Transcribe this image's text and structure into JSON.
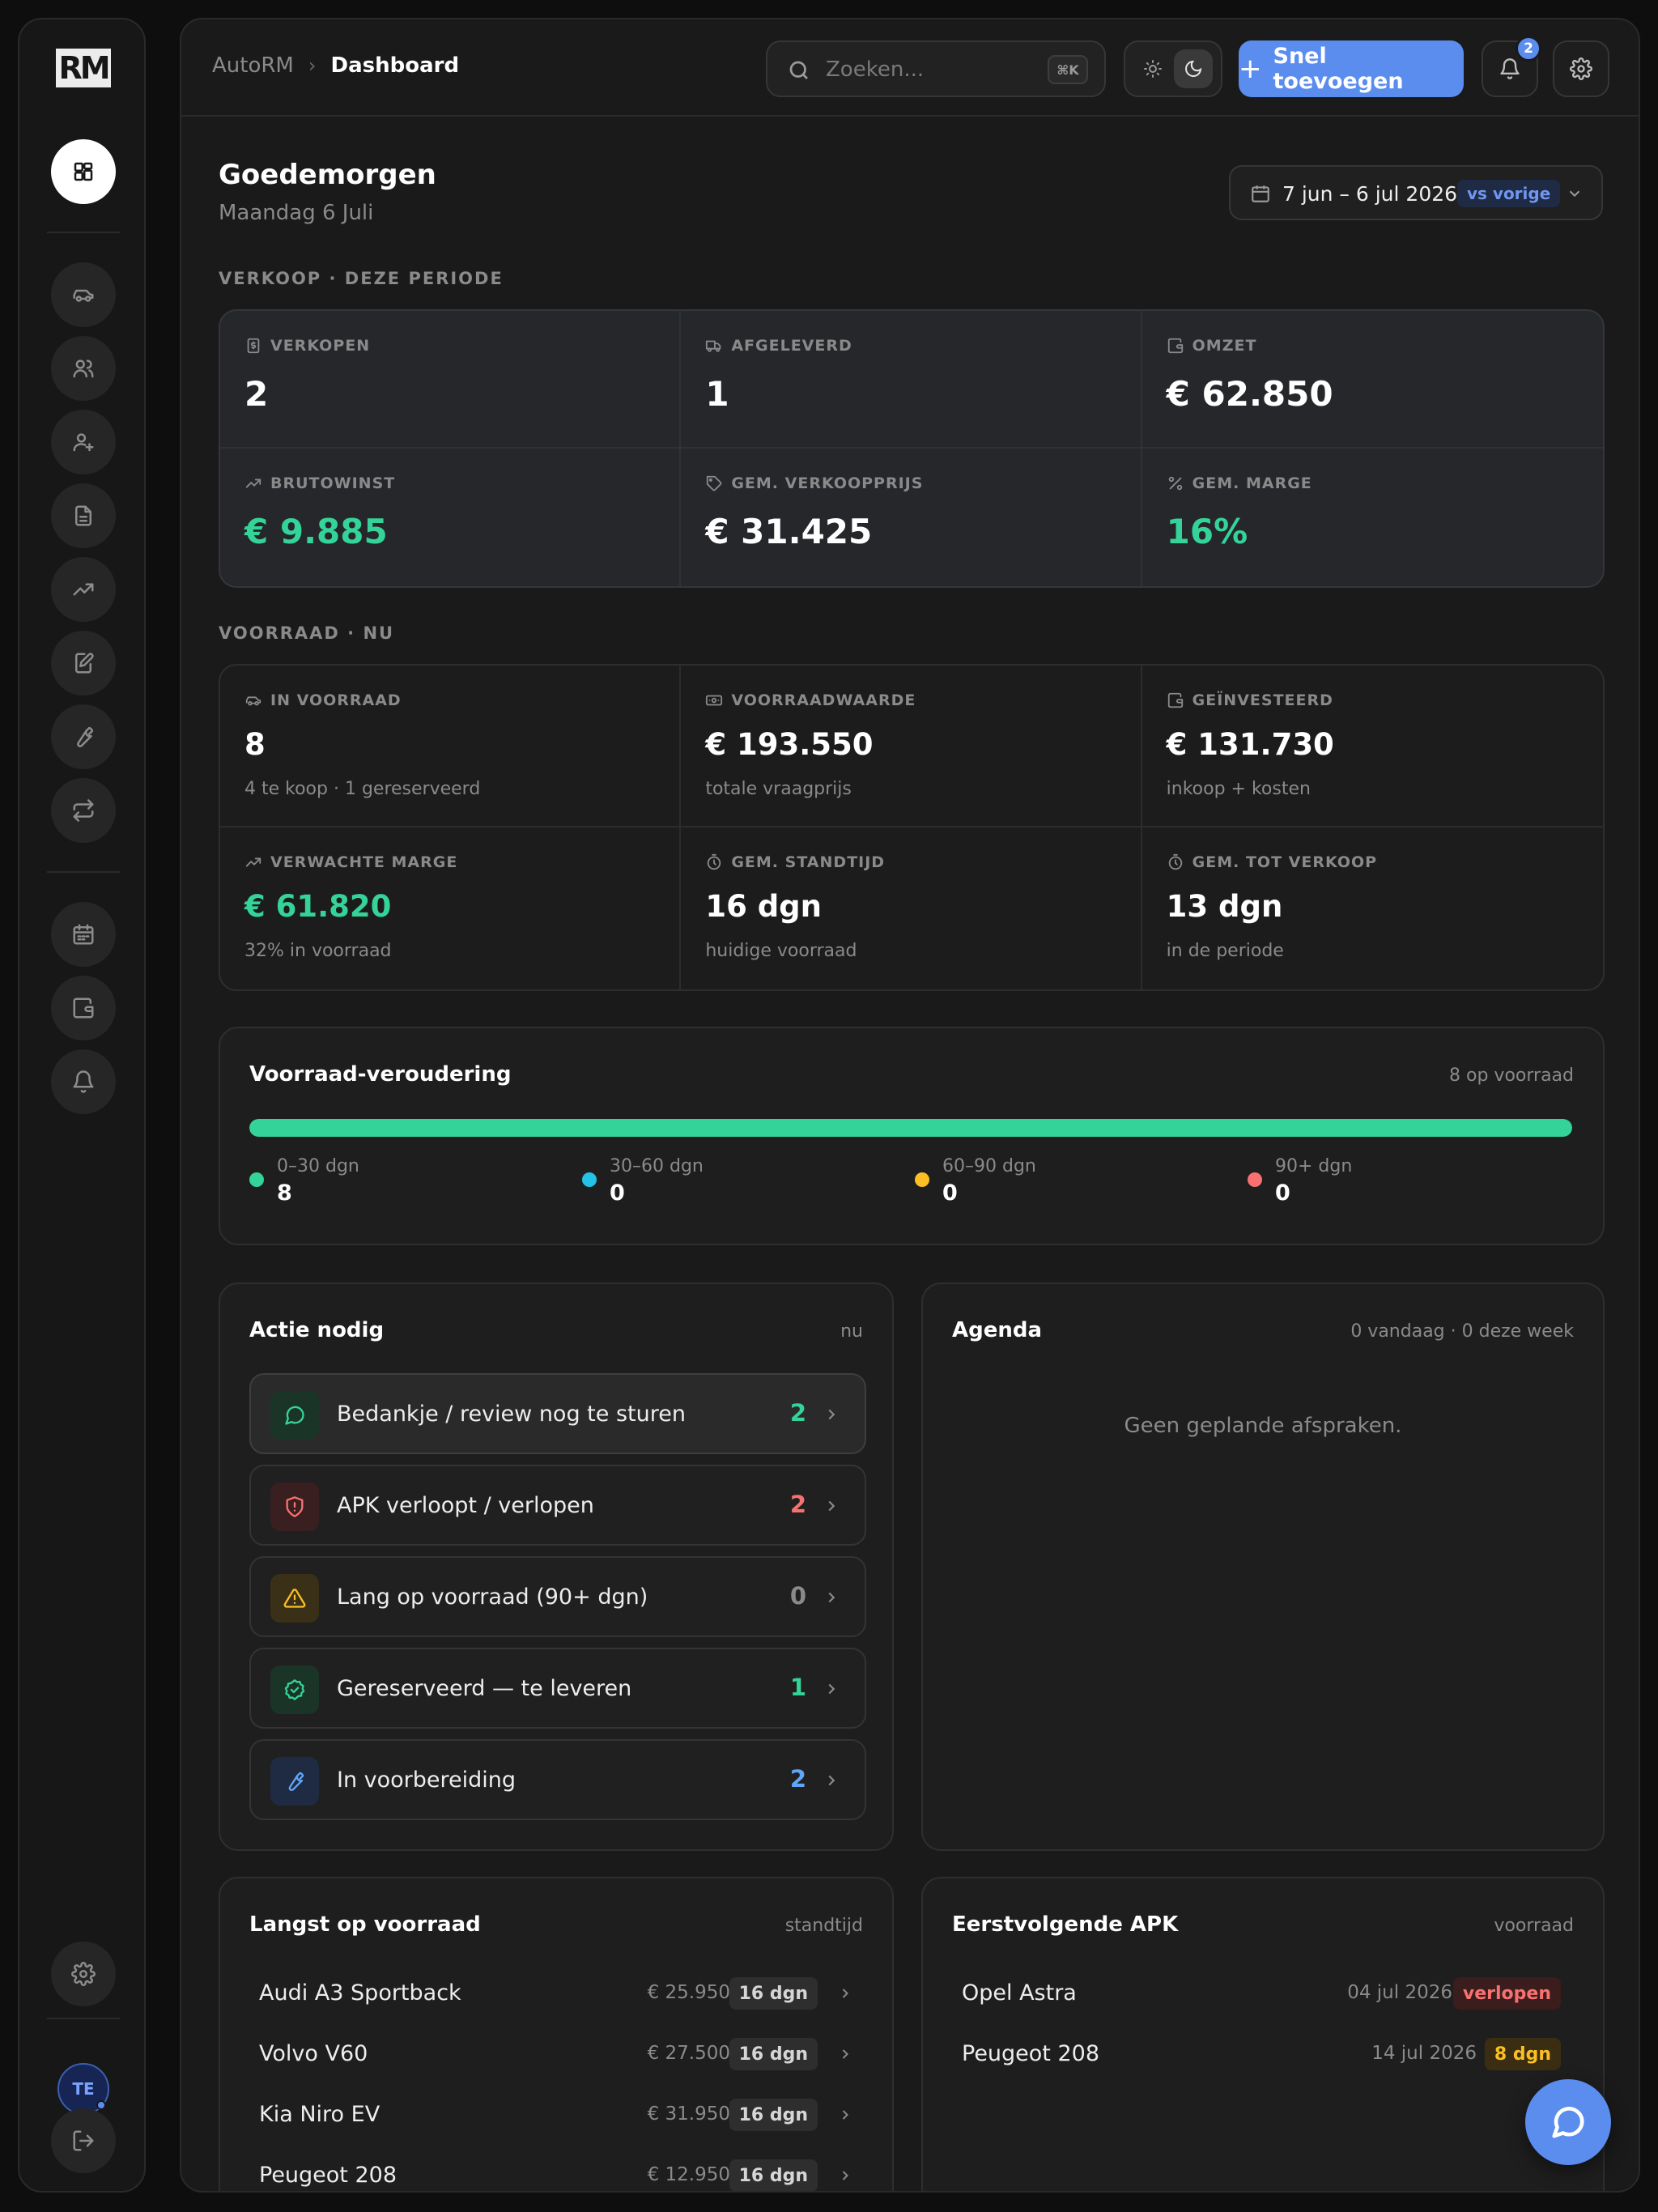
{
  "app": {
    "logo": "RM"
  },
  "breadcrumb": {
    "root": "AutoRM",
    "current": "Dashboard"
  },
  "search": {
    "placeholder": "Zoeken...",
    "shortcut": "⌘K"
  },
  "quick_add": {
    "label": "Snel toevoegen"
  },
  "notifications": {
    "count": "2"
  },
  "user": {
    "initials": "TE"
  },
  "sidebar": {
    "items": [
      {
        "icon": "dashboard-icon",
        "active": true
      },
      {
        "icon": "car-icon"
      },
      {
        "icon": "users-icon"
      },
      {
        "icon": "user-plus-icon"
      },
      {
        "icon": "document-icon"
      },
      {
        "icon": "trending-up-icon"
      },
      {
        "icon": "edit-document-icon"
      },
      {
        "icon": "wrench-icon"
      },
      {
        "icon": "repeat-icon"
      },
      {
        "icon": "calendar-icon"
      },
      {
        "icon": "wallet-icon"
      },
      {
        "icon": "bell-icon"
      }
    ],
    "bottom": [
      {
        "icon": "settings-icon"
      },
      {
        "icon": "logout-icon"
      }
    ]
  },
  "header": {
    "greeting": "Goedemorgen",
    "date": "Maandag 6 Juli",
    "range": "7 jun – 6 jul 2026",
    "compare": "vs vorige"
  },
  "sales": {
    "title": "VERKOOP · DEZE PERIODE",
    "stats": [
      {
        "label": "VERKOPEN",
        "value": "2",
        "icon": "dollar-doc-icon"
      },
      {
        "label": "AFGELEVERD",
        "value": "1",
        "icon": "truck-icon"
      },
      {
        "label": "OMZET",
        "value": "€ 62.850",
        "icon": "wallet-icon"
      },
      {
        "label": "BRUTOWINST",
        "value": "€ 9.885",
        "icon": "trending-up-icon",
        "accent": "#34d399"
      },
      {
        "label": "GEM. VERKOOPPRIJS",
        "value": "€ 31.425",
        "icon": "tag-icon"
      },
      {
        "label": "GEM. MARGE",
        "value": "16%",
        "icon": "percent-icon",
        "accent": "#34d399"
      }
    ]
  },
  "stock": {
    "title": "VOORRAAD · NU",
    "stats": [
      {
        "label": "IN VOORRAAD",
        "value": "8",
        "sub": "4 te koop · 1 gereserveerd",
        "icon": "car-icon"
      },
      {
        "label": "VOORRAADWAARDE",
        "value": "€ 193.550",
        "sub": "totale vraagprijs",
        "icon": "banknote-icon"
      },
      {
        "label": "GEÏNVESTEERD",
        "value": "€ 131.730",
        "sub": "inkoop + kosten",
        "icon": "wallet-icon"
      },
      {
        "label": "VERWACHTE MARGE",
        "value": "€ 61.820",
        "sub": "32% in voorraad",
        "icon": "trending-up-icon",
        "accent": "#34d399"
      },
      {
        "label": "GEM. STANDTIJD",
        "value": "16 dgn",
        "sub": "huidige voorraad",
        "icon": "timer-icon"
      },
      {
        "label": "GEM. TOT VERKOOP",
        "value": "13 dgn",
        "sub": "in de periode",
        "icon": "timer-icon"
      }
    ]
  },
  "aging": {
    "title": "Voorraad-veroudering",
    "meta": "8 op voorraad",
    "fill_fraction": 1.0,
    "buckets": [
      {
        "label": "0–30 dgn",
        "value": "8",
        "color": "#34d399"
      },
      {
        "label": "30–60 dgn",
        "value": "0",
        "color": "#22c3e6"
      },
      {
        "label": "60–90 dgn",
        "value": "0",
        "color": "#fbbf24"
      },
      {
        "label": "90+ dgn",
        "value": "0",
        "color": "#f87171"
      }
    ]
  },
  "actions": {
    "title": "Actie nodig",
    "meta": "nu",
    "items": [
      {
        "label": "Bedankje / review nog te sturen",
        "count": "2",
        "icon": "message-icon",
        "color": "#34d399",
        "bg": "#1b3428"
      },
      {
        "label": "APK verloopt / verlopen",
        "count": "2",
        "icon": "shield-alert-icon",
        "color": "#f87171",
        "bg": "#3a1f20"
      },
      {
        "label": "Lang op voorraad (90+ dgn)",
        "count": "0",
        "icon": "warning-icon",
        "color": "#fbbf24",
        "bg": "#3a3018",
        "count_color": "#8a8a8a"
      },
      {
        "label": "Gereserveerd — te leveren",
        "count": "1",
        "icon": "check-badge-icon",
        "color": "#34d399",
        "bg": "#1b3428"
      },
      {
        "label": "In voorbereiding",
        "count": "2",
        "icon": "wrench-icon",
        "color": "#60a5fa",
        "bg": "#1e2b43"
      }
    ]
  },
  "agenda": {
    "title": "Agenda",
    "meta": "0 vandaag · 0 deze week",
    "empty": "Geen geplande afspraken."
  },
  "longest": {
    "title": "Langst op voorraad",
    "meta": "standtijd",
    "rows": [
      {
        "name": "Audi A3 Sportback",
        "price": "€ 25.950",
        "days": "16 dgn"
      },
      {
        "name": "Volvo V60",
        "price": "€ 27.500",
        "days": "16 dgn"
      },
      {
        "name": "Kia Niro EV",
        "price": "€ 31.950",
        "days": "16 dgn"
      },
      {
        "name": "Peugeot 208",
        "price": "€ 12.950",
        "days": "16 dgn"
      }
    ]
  },
  "apk": {
    "title": "Eerstvolgende APK",
    "meta": "voorraad",
    "rows": [
      {
        "name": "Opel Astra",
        "date": "04 jul 2026",
        "status": "verlopen",
        "tone": "red"
      },
      {
        "name": "Peugeot 208",
        "date": "14 jul 2026",
        "status": "8 dgn",
        "tone": "amber"
      }
    ]
  },
  "chat": {
    "icon": "chat-icon"
  }
}
